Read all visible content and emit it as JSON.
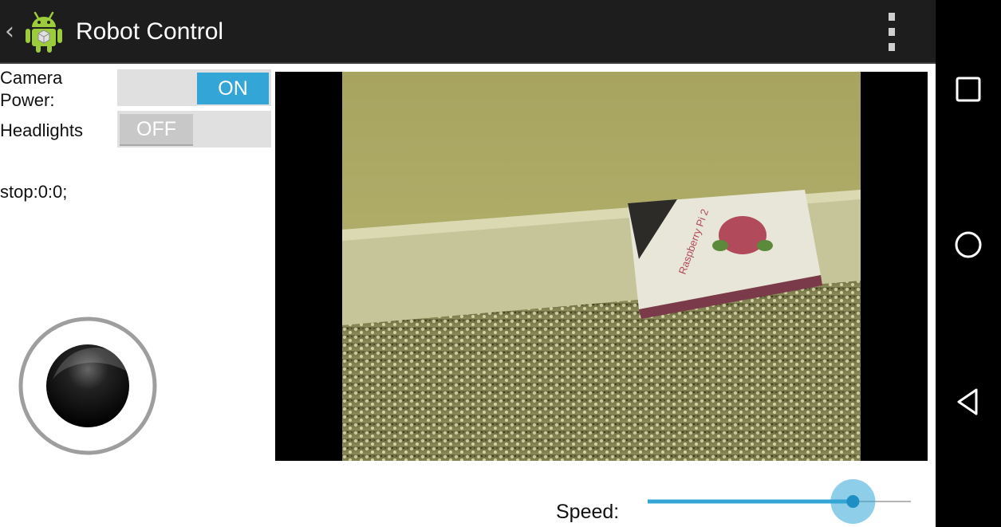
{
  "action_bar": {
    "title": "Robot Control",
    "back_icon": "chevron-left-icon",
    "app_icon": "android-robot-icon",
    "menu_icon": "overflow-menu-icon"
  },
  "controls": {
    "camera_power": {
      "label_line1": "Camera",
      "label_line2": "Power:",
      "state": "ON"
    },
    "headlights": {
      "label": "Headlights",
      "state": "OFF"
    },
    "status": "stop:0:0;"
  },
  "speed": {
    "label": "Speed:",
    "value_fraction": 0.78
  },
  "navigation": {
    "recents_icon": "recents-square-icon",
    "home_icon": "home-circle-icon",
    "back_icon": "back-triangle-icon"
  },
  "colors": {
    "accent": "#33a5d6",
    "action_bar": "#1d1d1d",
    "toggle_off": "#c8c8c8"
  }
}
